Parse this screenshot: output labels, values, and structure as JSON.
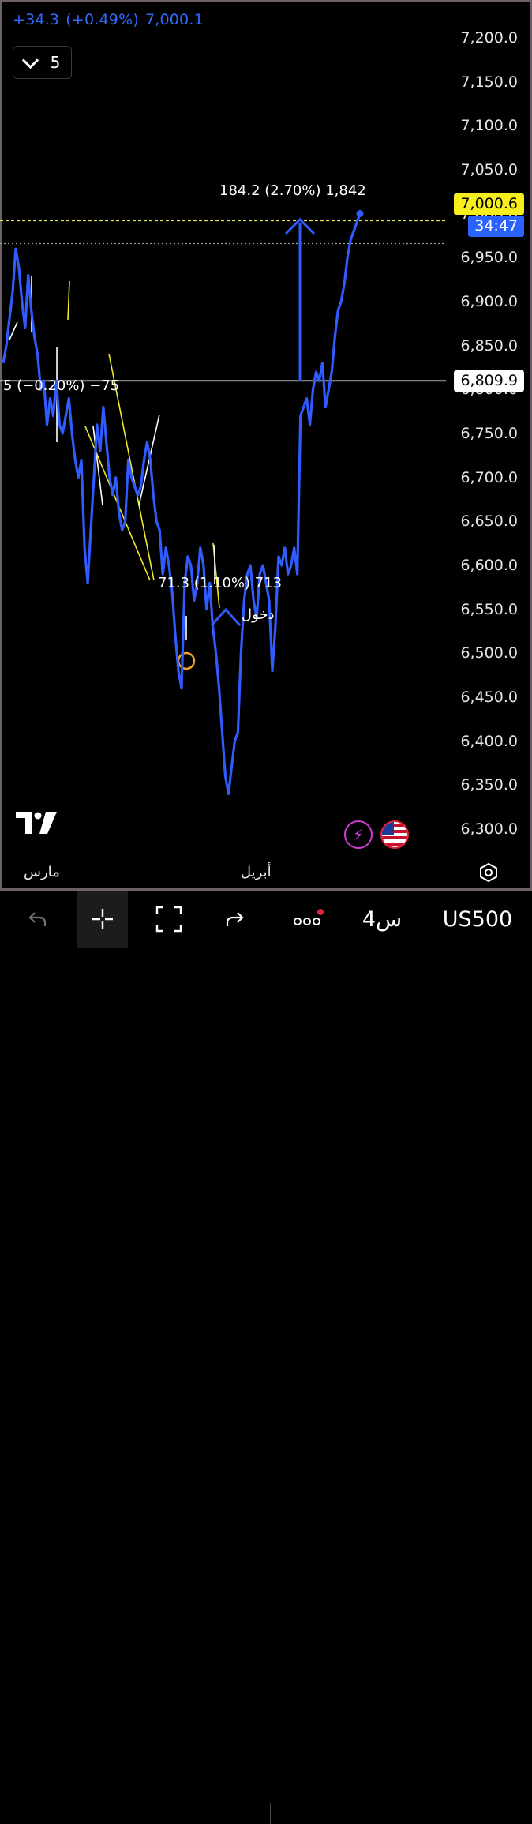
{
  "header": {
    "change": "+34.3",
    "change_pct": "(+0.49%)",
    "last_price": "7,000.1",
    "interval_value": "5"
  },
  "chart_data": {
    "type": "line",
    "series": [
      {
        "color": "#2f5bff",
        "y": [
          6830,
          6850,
          6880,
          6910,
          6960,
          6940,
          6900,
          6870,
          6930,
          6890,
          6860,
          6840,
          6800,
          6810,
          6760,
          6790,
          6770,
          6810,
          6760,
          6750,
          6770,
          6790,
          6750,
          6720,
          6700,
          6720,
          6620,
          6580,
          6640,
          6700,
          6760,
          6730,
          6780,
          6740,
          6700,
          6680,
          6700,
          6660,
          6640,
          6650,
          6720,
          6700,
          6690,
          6680,
          6690,
          6720,
          6740,
          6720,
          6680,
          6650,
          6640,
          6590,
          6620,
          6600,
          6570,
          6520,
          6480,
          6460,
          6580,
          6610,
          6600,
          6560,
          6580,
          6620,
          6600,
          6550,
          6580,
          6530,
          6500,
          6460,
          6410,
          6360,
          6340,
          6370,
          6400,
          6410,
          6500,
          6560,
          6590,
          6600,
          6560,
          6540,
          6590,
          6600,
          6580,
          6560,
          6480,
          6530,
          6610,
          6600,
          6620,
          6590,
          6600,
          6620,
          6590,
          6770,
          6780,
          6790,
          6760,
          6800,
          6820,
          6810,
          6830,
          6780,
          6800,
          6820,
          6860,
          6890,
          6900,
          6920,
          6950,
          6970,
          6980,
          6990,
          7000.1
        ]
      }
    ],
    "ylim": [
      6280,
      7225
    ],
    "yticks": [
      "7,200.0",
      "7,150.0",
      "7,100.0",
      "7,050.0",
      "7,000.0",
      "6,950.0",
      "6,900.0",
      "6,850.0",
      "6,800.0",
      "6,750.0",
      "6,700.0",
      "6,650.0",
      "6,600.0",
      "6,550.0",
      "6,500.0",
      "6,450.0",
      "6,400.0",
      "6,350.0",
      "6,300.0"
    ],
    "ytick_values": [
      7200,
      7150,
      7100,
      7050,
      7000,
      6950,
      6900,
      6850,
      6800,
      6750,
      6700,
      6650,
      6600,
      6550,
      6500,
      6450,
      6400,
      6350,
      6300
    ],
    "xlabels": [
      "مارس",
      "أبريل"
    ],
    "hlines": [
      {
        "value": 6992,
        "style": "dashed",
        "color": "#e8e35a"
      },
      {
        "value": 6966,
        "style": "dotted",
        "color": "#9a9a9a"
      },
      {
        "value": 6809.9,
        "style": "solid",
        "color": "#ffffff"
      }
    ],
    "price_tags": [
      {
        "text": "7,000.6",
        "style": "yellow",
        "value": 7011
      },
      {
        "text": "34:47",
        "style": "blue",
        "value": 6986
      },
      {
        "text": "6,809.9",
        "style": "white",
        "value": 6809.9
      }
    ],
    "annotations": [
      {
        "text": "184.2 (2.70%) 1,842"
      },
      {
        "text": "5 (−0.20%) −75"
      },
      {
        "text": "71.3 (1.10%) 713"
      },
      {
        "text": "دخول"
      }
    ]
  },
  "bottom_bar": {
    "symbol": "US500",
    "timeframe": "4س",
    "icons": [
      "undo-icon",
      "crosshair-icon",
      "fullscreen-icon",
      "redo-icon",
      "more-icon"
    ]
  }
}
